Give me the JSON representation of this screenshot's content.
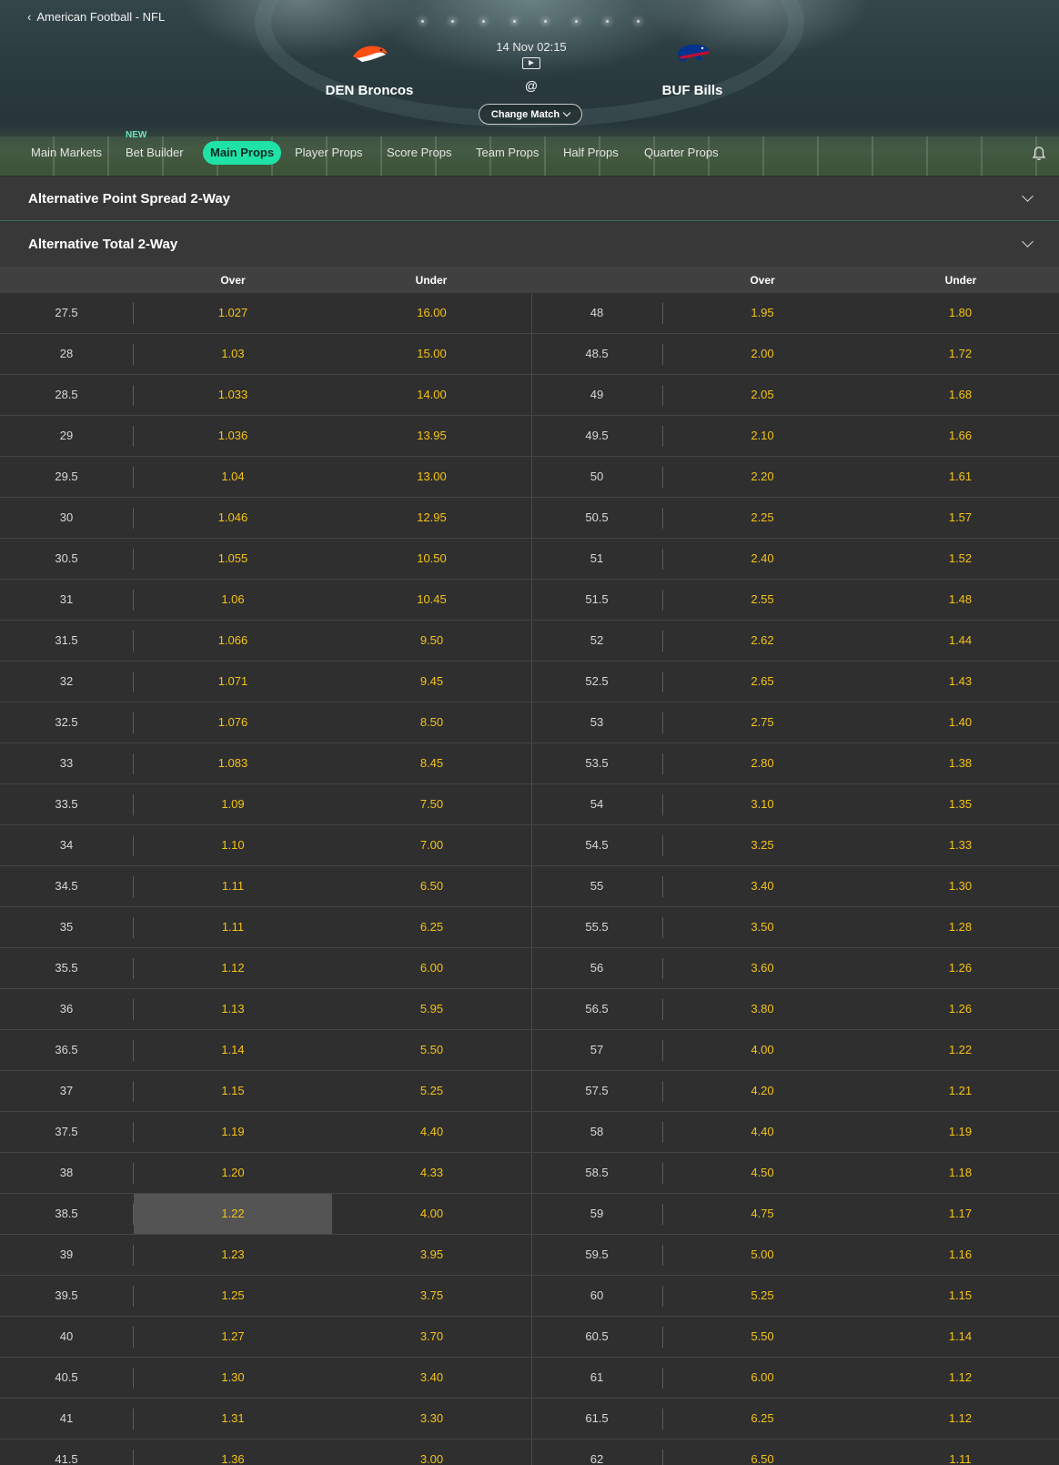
{
  "header": {
    "back_label": "American Football - NFL",
    "home_team": "DEN Broncos",
    "away_team": "BUF Bills",
    "match_time": "14 Nov 02:15",
    "at_sign": "@",
    "change_match": "Change Match"
  },
  "tabs": [
    {
      "label": "Main Markets"
    },
    {
      "label": "Bet Builder",
      "badge": "NEW"
    },
    {
      "label": "Main Props",
      "active": true
    },
    {
      "label": "Player Props"
    },
    {
      "label": "Score Props"
    },
    {
      "label": "Team Props"
    },
    {
      "label": "Half Props"
    },
    {
      "label": "Quarter Props"
    }
  ],
  "accordions": [
    {
      "title": "Alternative Point Spread 2-Way"
    },
    {
      "title": "Alternative Total 2-Way"
    }
  ],
  "table": {
    "headers": {
      "over": "Over",
      "under": "Under"
    },
    "rows": [
      [
        "27.5",
        "1.027",
        "16.00",
        "48",
        "1.95",
        "1.80"
      ],
      [
        "28",
        "1.03",
        "15.00",
        "48.5",
        "2.00",
        "1.72"
      ],
      [
        "28.5",
        "1.033",
        "14.00",
        "49",
        "2.05",
        "1.68"
      ],
      [
        "29",
        "1.036",
        "13.95",
        "49.5",
        "2.10",
        "1.66"
      ],
      [
        "29.5",
        "1.04",
        "13.00",
        "50",
        "2.20",
        "1.61"
      ],
      [
        "30",
        "1.046",
        "12.95",
        "50.5",
        "2.25",
        "1.57"
      ],
      [
        "30.5",
        "1.055",
        "10.50",
        "51",
        "2.40",
        "1.52"
      ],
      [
        "31",
        "1.06",
        "10.45",
        "51.5",
        "2.55",
        "1.48"
      ],
      [
        "31.5",
        "1.066",
        "9.50",
        "52",
        "2.62",
        "1.44"
      ],
      [
        "32",
        "1.071",
        "9.45",
        "52.5",
        "2.65",
        "1.43"
      ],
      [
        "32.5",
        "1.076",
        "8.50",
        "53",
        "2.75",
        "1.40"
      ],
      [
        "33",
        "1.083",
        "8.45",
        "53.5",
        "2.80",
        "1.38"
      ],
      [
        "33.5",
        "1.09",
        "7.50",
        "54",
        "3.10",
        "1.35"
      ],
      [
        "34",
        "1.10",
        "7.00",
        "54.5",
        "3.25",
        "1.33"
      ],
      [
        "34.5",
        "1.11",
        "6.50",
        "55",
        "3.40",
        "1.30"
      ],
      [
        "35",
        "1.11",
        "6.25",
        "55.5",
        "3.50",
        "1.28"
      ],
      [
        "35.5",
        "1.12",
        "6.00",
        "56",
        "3.60",
        "1.26"
      ],
      [
        "36",
        "1.13",
        "5.95",
        "56.5",
        "3.80",
        "1.26"
      ],
      [
        "36.5",
        "1.14",
        "5.50",
        "57",
        "4.00",
        "1.22"
      ],
      [
        "37",
        "1.15",
        "5.25",
        "57.5",
        "4.20",
        "1.21"
      ],
      [
        "37.5",
        "1.19",
        "4.40",
        "58",
        "4.40",
        "1.19"
      ],
      [
        "38",
        "1.20",
        "4.33",
        "58.5",
        "4.50",
        "1.18"
      ],
      [
        "38.5",
        "1.22",
        "4.00",
        "59",
        "4.75",
        "1.17"
      ],
      [
        "39",
        "1.23",
        "3.95",
        "59.5",
        "5.00",
        "1.16"
      ],
      [
        "39.5",
        "1.25",
        "3.75",
        "60",
        "5.25",
        "1.15"
      ],
      [
        "40",
        "1.27",
        "3.70",
        "60.5",
        "5.50",
        "1.14"
      ],
      [
        "40.5",
        "1.30",
        "3.40",
        "61",
        "6.00",
        "1.12"
      ],
      [
        "41",
        "1.31",
        "3.30",
        "61.5",
        "6.25",
        "1.12"
      ],
      [
        "41.5",
        "1.36",
        "3.00",
        "62",
        "6.50",
        "1.11"
      ]
    ],
    "selected": {
      "row": 22,
      "col": 1
    }
  },
  "colors": {
    "accent": "#1fe2a6",
    "odds": "#f5c316",
    "background": "#2f2f2f"
  },
  "icons": [
    "chevron-left-icon",
    "broncos-logo-icon",
    "bills-logo-icon",
    "play-icon",
    "chevron-down-icon",
    "bell-icon"
  ]
}
